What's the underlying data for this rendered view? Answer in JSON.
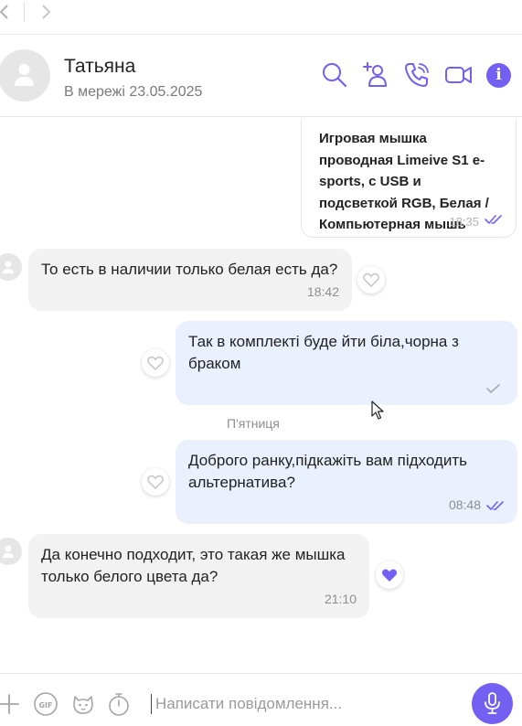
{
  "header": {
    "contact_name": "Татьяна",
    "status": "В мережі 23.05.2025",
    "info_label": "i"
  },
  "colors": {
    "accent": "#7360f2",
    "incoming_bubble": "#f2f2f2",
    "outgoing_bubble": "#eaf0fd"
  },
  "messages": [
    {
      "direction": "outgoing",
      "kind": "product-card",
      "text": "Игровая мышка проводная Limeive S1 e-sports, с USB и подсветкой RGB, Белая / Компьютерная мышь",
      "time": "18:35",
      "status": "read"
    },
    {
      "direction": "incoming",
      "text": "То есть в наличии только белая есть да?",
      "time": "18:42",
      "liked": false
    },
    {
      "direction": "outgoing",
      "text": "Так в комплекті буде йти біла,чорна з браком",
      "time": "",
      "status": "sent",
      "liked": false
    },
    {
      "direction": "outgoing",
      "text": "Доброго ранку,підкажіть вам підходить альтернатива?",
      "time": "08:48",
      "status": "read",
      "liked": false
    },
    {
      "direction": "incoming",
      "text": "Да конечно подходит, это такая же мышка только белого цвета да?",
      "time": "21:10",
      "liked": true
    }
  ],
  "day_separator": "П'ятниця",
  "composer": {
    "placeholder": "Написати повідомлення...",
    "value": ""
  }
}
